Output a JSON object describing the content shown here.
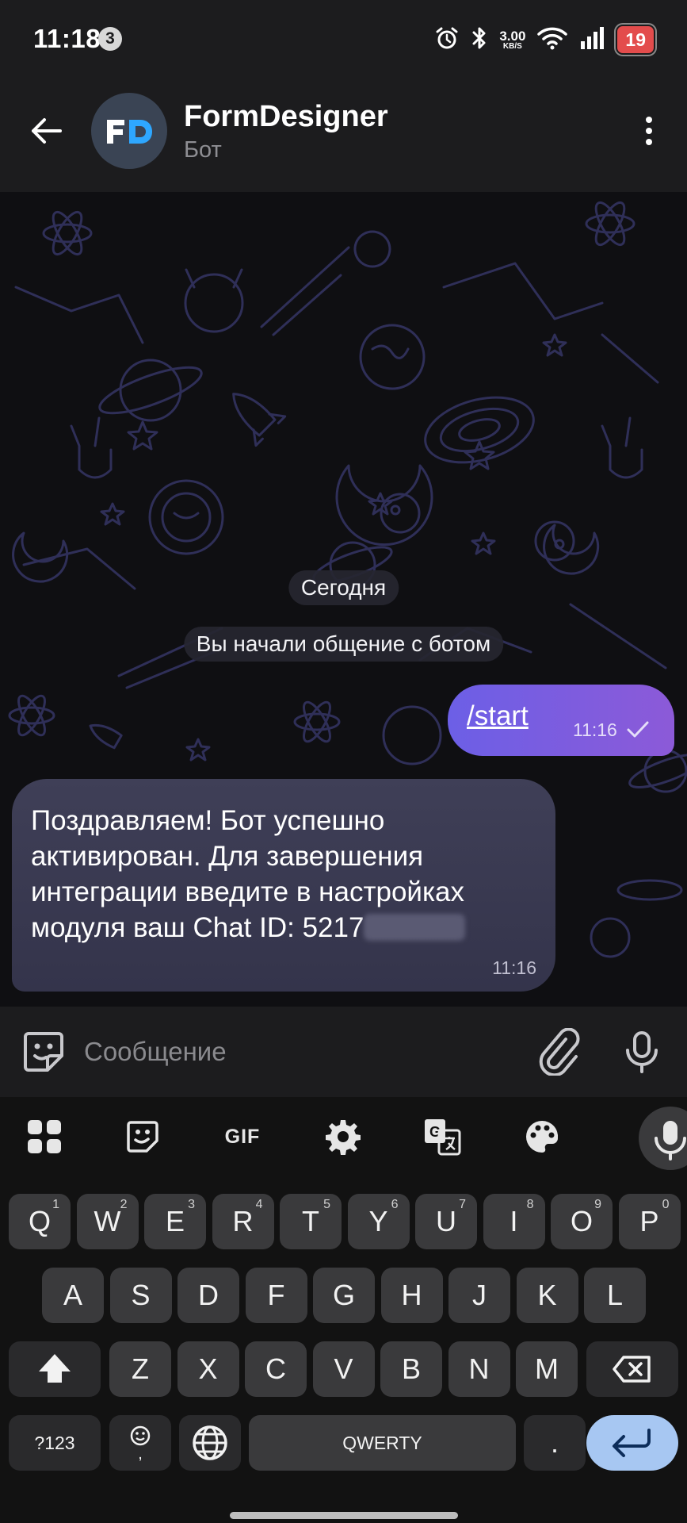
{
  "status_bar": {
    "time": "11:18",
    "notification_count": "3",
    "net_speed_value": "3.00",
    "net_speed_unit": "KB/S",
    "battery": "19",
    "battery_color": "#e34c4c",
    "icons": [
      "alarm-icon",
      "bluetooth-icon",
      "wifi-icon",
      "signal-icon"
    ]
  },
  "header": {
    "title": "FormDesigner",
    "subtitle": "Бот",
    "avatar_letters": "FD",
    "avatar_accent": "#2ea7ff"
  },
  "chat": {
    "date_pill": "Сегодня",
    "service_message": "Вы начали общение с ботом",
    "outgoing": {
      "text": "/start",
      "time": "11:16",
      "status": "sent-check"
    },
    "incoming": {
      "text": "Поздравляем! Бот успешно активирован. Для завершения интеграции введите в настройках модуля ваш Chat ID: 5217",
      "time": "11:16",
      "redacted": true
    },
    "bubble_out_colors": [
      "#6c5fe6",
      "#8c5ad8"
    ],
    "bubble_in_color": "#3f3f57"
  },
  "input": {
    "placeholder": "Сообщение"
  },
  "keyboard": {
    "toolbar": [
      "apps-icon",
      "sticker-icon",
      "GIF",
      "settings-icon",
      "translate-icon",
      "palette-icon",
      "mic-icon"
    ],
    "gif_label": "GIF",
    "row1": [
      {
        "k": "Q",
        "s": "1"
      },
      {
        "k": "W",
        "s": "2"
      },
      {
        "k": "E",
        "s": "3"
      },
      {
        "k": "R",
        "s": "4"
      },
      {
        "k": "T",
        "s": "5"
      },
      {
        "k": "Y",
        "s": "6"
      },
      {
        "k": "U",
        "s": "7"
      },
      {
        "k": "I",
        "s": "8"
      },
      {
        "k": "O",
        "s": "9"
      },
      {
        "k": "P",
        "s": "0"
      }
    ],
    "row2": [
      "A",
      "S",
      "D",
      "F",
      "G",
      "H",
      "J",
      "K",
      "L"
    ],
    "row3": [
      "Z",
      "X",
      "C",
      "V",
      "B",
      "N",
      "M"
    ],
    "symbols_key": "?123",
    "emoji_key_sub": ",",
    "space_label": "QWERTY",
    "period_key": "."
  }
}
